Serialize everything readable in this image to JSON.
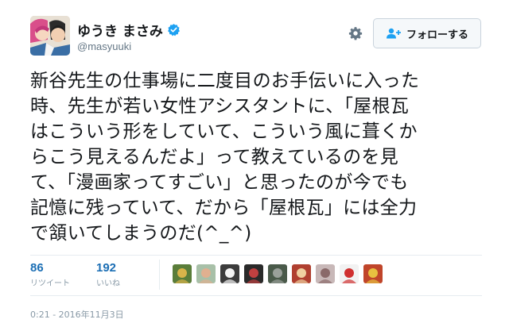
{
  "user": {
    "display_name": "ゆうき まさみ",
    "screen_name": "@masyuuki",
    "verified": true,
    "avatar_icon": "user-avatar"
  },
  "follow_button": {
    "label": "フォローする",
    "icon": "follow-person-plus-icon"
  },
  "settings_icon": "gear-icon",
  "tweet": {
    "lines": [
      "新谷先生の仕事場に二度目のお手伝いに入った",
      "時、先生が若い女性アシスタントに、「屋根瓦",
      "はこういう形をしていて、こういう風に葺くか",
      "らこう見えるんだよ」って教えているのを見",
      "て、「漫画家ってすごい」と思ったのが今でも",
      "記憶に残っていて、だから「屋根瓦」には全力",
      "で頷いてしまうのだ(^_^)"
    ]
  },
  "stats": {
    "retweets": {
      "count": "86",
      "label": "リツイート"
    },
    "likes": {
      "count": "192",
      "label": "いいね"
    }
  },
  "likers": [
    {
      "color": "#5a7d3a",
      "accent": "#d9b44a"
    },
    {
      "color": "#a8c0a8",
      "accent": "#e0b090"
    },
    {
      "color": "#3c3c3c",
      "accent": "#f4f4f4"
    },
    {
      "color": "#2a2a2a",
      "accent": "#c04040"
    },
    {
      "color": "#4a5a4a",
      "accent": "#9aa09a"
    },
    {
      "color": "#b04030",
      "accent": "#f0d0a0"
    },
    {
      "color": "#c8b8b8",
      "accent": "#8a6a6a"
    },
    {
      "color": "#f2f2f2",
      "accent": "#d03030"
    },
    {
      "color": "#c0452a",
      "accent": "#e8c040"
    }
  ],
  "timestamp": "0:21 - 2016年11月3日",
  "colors": {
    "link_blue": "#1b6eb4",
    "verified_blue": "#1da1f2",
    "muted_gray": "#8899a6"
  }
}
